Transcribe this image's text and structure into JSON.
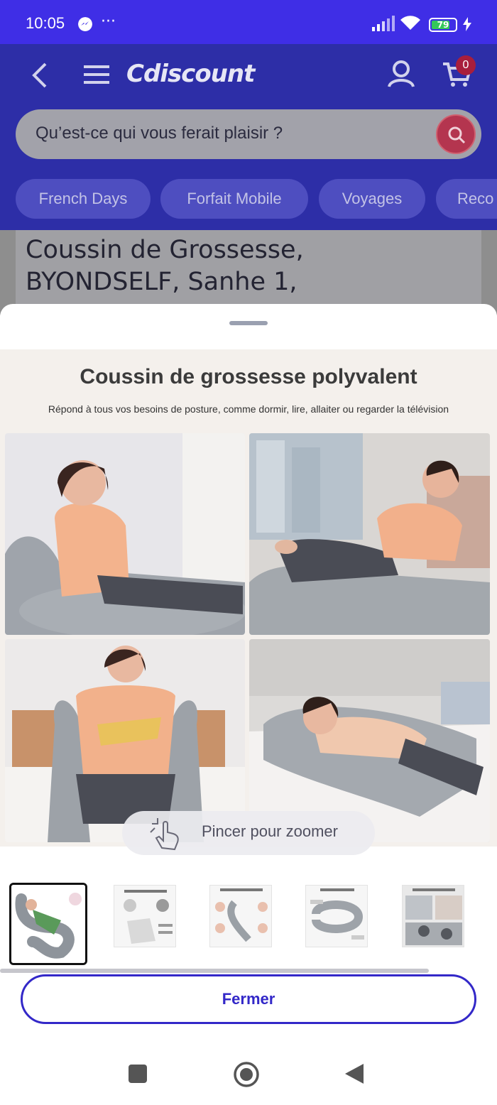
{
  "status_bar": {
    "time": "10:05",
    "battery": "79",
    "battery_fraction": 0.79
  },
  "header": {
    "logo": "Cdiscount",
    "cart_count": "0",
    "search": {
      "placeholder": "Qu’est-ce qui vous ferait plaisir ?"
    },
    "chips": [
      "French Days",
      "Forfait Mobile",
      "Voyages",
      "Reco"
    ]
  },
  "product": {
    "title_line1": "Coussin de Grossesse,",
    "title_line2": "BYONDSELF, Sanhe 1,"
  },
  "gallery": {
    "hero_title": "Coussin de grossesse polyvalent",
    "hero_subtitle": "Répond à tous vos besoins de posture, comme dormir, lire, allaiter ou regarder la télévision",
    "zoom_hint": "Pincer pour zoomer",
    "thumbnail_count": 5,
    "active_thumbnail": 1
  },
  "actions": {
    "close_label": "Fermer"
  },
  "colors": {
    "status_bar": "#3f2ee6",
    "header_dimmed": "#2d2ea7",
    "accent": "#3328c8",
    "search_button": "#b4354f"
  }
}
